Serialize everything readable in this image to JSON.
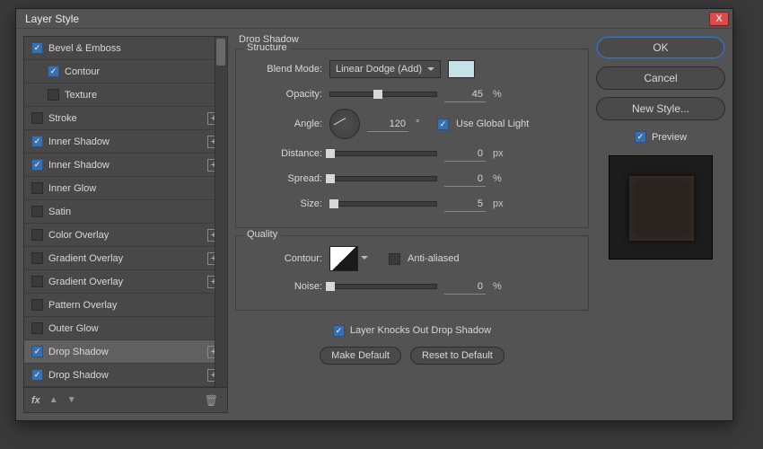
{
  "dialog": {
    "title": "Layer Style"
  },
  "closebtn": "X",
  "sidelist": {
    "items": [
      {
        "label": "Bevel & Emboss",
        "checked": true,
        "sub": false,
        "add": false
      },
      {
        "label": "Contour",
        "checked": true,
        "sub": true,
        "add": false
      },
      {
        "label": "Texture",
        "checked": false,
        "sub": true,
        "add": false
      },
      {
        "label": "Stroke",
        "checked": false,
        "sub": false,
        "add": true
      },
      {
        "label": "Inner Shadow",
        "checked": true,
        "sub": false,
        "add": true
      },
      {
        "label": "Inner Shadow",
        "checked": true,
        "sub": false,
        "add": true
      },
      {
        "label": "Inner Glow",
        "checked": false,
        "sub": false,
        "add": false
      },
      {
        "label": "Satin",
        "checked": false,
        "sub": false,
        "add": false
      },
      {
        "label": "Color Overlay",
        "checked": false,
        "sub": false,
        "add": true
      },
      {
        "label": "Gradient Overlay",
        "checked": false,
        "sub": false,
        "add": true
      },
      {
        "label": "Gradient Overlay",
        "checked": false,
        "sub": false,
        "add": true
      },
      {
        "label": "Pattern Overlay",
        "checked": false,
        "sub": false,
        "add": false
      },
      {
        "label": "Outer Glow",
        "checked": false,
        "sub": false,
        "add": false
      },
      {
        "label": "Drop Shadow",
        "checked": true,
        "sub": false,
        "add": true,
        "selected": true
      },
      {
        "label": "Drop Shadow",
        "checked": true,
        "sub": false,
        "add": true
      }
    ],
    "footer": {
      "fx": "fx"
    }
  },
  "panel": {
    "title": "Drop Shadow",
    "structure": {
      "legend": "Structure",
      "blend_mode_label": "Blend Mode:",
      "blend_mode_value": "Linear Dodge (Add)",
      "color_swatch": "#c7e1e8",
      "opacity_label": "Opacity:",
      "opacity_value": "45",
      "opacity_unit": "%",
      "opacity_knob_pct": 45,
      "angle_label": "Angle:",
      "angle_value": "120",
      "angle_unit": "°",
      "use_global_light_label": "Use Global Light",
      "use_global_light_checked": true,
      "distance_label": "Distance:",
      "distance_value": "0",
      "distance_unit": "px",
      "distance_knob_pct": 0,
      "spread_label": "Spread:",
      "spread_value": "0",
      "spread_unit": "%",
      "spread_knob_pct": 0,
      "size_label": "Size:",
      "size_value": "5",
      "size_unit": "px",
      "size_knob_pct": 3
    },
    "quality": {
      "legend": "Quality",
      "contour_label": "Contour:",
      "antialiased_label": "Anti-aliased",
      "antialiased_checked": false,
      "noise_label": "Noise:",
      "noise_value": "0",
      "noise_unit": "%",
      "noise_knob_pct": 0
    },
    "knockout_label": "Layer Knocks Out Drop Shadow",
    "knockout_checked": true,
    "make_default": "Make Default",
    "reset_default": "Reset to Default"
  },
  "right": {
    "ok": "OK",
    "cancel": "Cancel",
    "new_style": "New Style...",
    "preview_label": "Preview",
    "preview_checked": true
  }
}
